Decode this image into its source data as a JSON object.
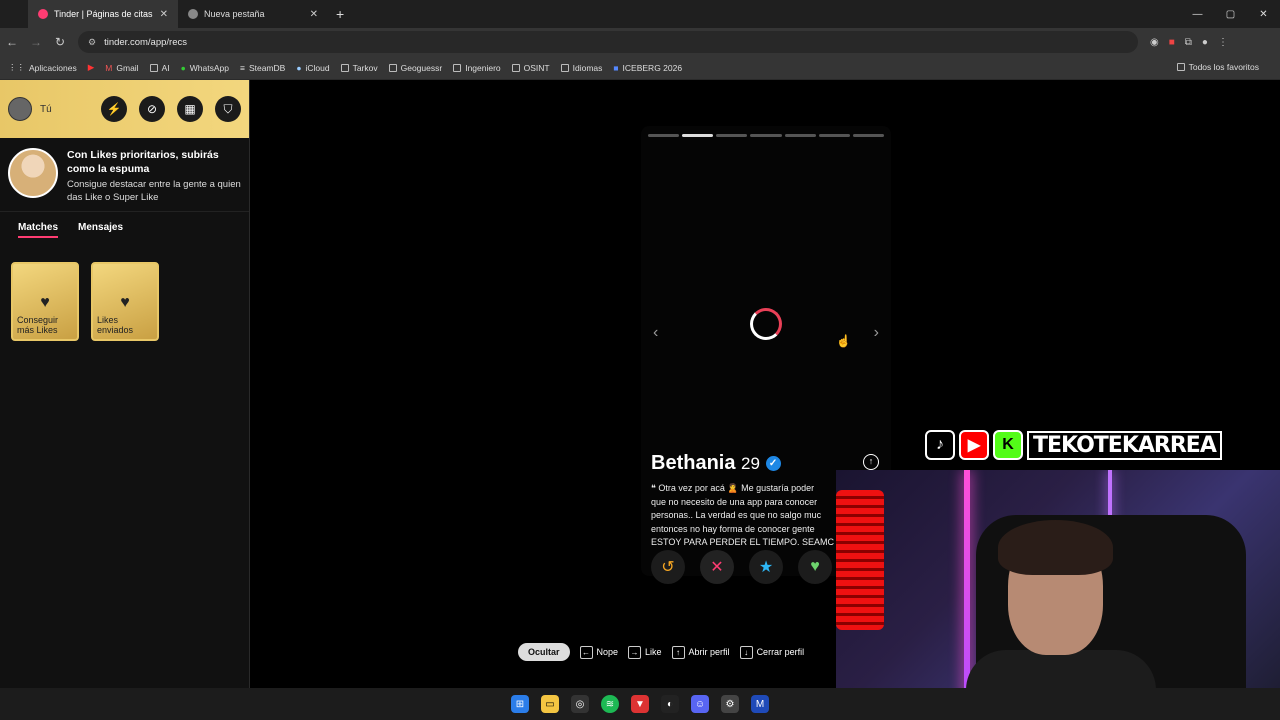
{
  "browser": {
    "tabs": [
      {
        "title": "Tinder | Páginas de citas",
        "active": true
      },
      {
        "title": "Nueva pestaña",
        "active": false
      }
    ],
    "url": "tinder.com/app/recs",
    "bookmarks": [
      "Aplicaciones",
      "Gmail",
      "AI",
      "WhatsApp",
      "SteamDB",
      "iCloud",
      "Tarkov",
      "Geoguessr",
      "Ingeniero",
      "OSINT",
      "Idiomas",
      "ICEBERG 2026"
    ],
    "bookmarks_right": "Todos los favoritos"
  },
  "sidebar": {
    "user_label": "Tú",
    "promo_title": "Con Likes prioritarios, subirás como la espuma",
    "promo_subtitle": "Consigue destacar entre la gente a quien das Like o Super Like",
    "tabs": [
      "Matches",
      "Mensajes"
    ],
    "cards": [
      "Conseguir más Likes",
      "Likes enviados"
    ]
  },
  "profile": {
    "name": "Bethania",
    "age": "29",
    "photo_count": 7,
    "current_photo": 2,
    "bio_lines": [
      "❝ Otra vez por acá 🙎 Me gustaría poder",
      "que no necesito de una app para conocer",
      "personas.. La verdad es que no salgo muc",
      "entonces no hay forma de conocer gente",
      "ESTOY PARA PERDER EL TIEMPO. SEAMC"
    ]
  },
  "shortcuts": {
    "hide_label": "Ocultar",
    "items": [
      "Nope",
      "Like",
      "Abrir perfil",
      "Cerrar perfil"
    ]
  },
  "overlay": {
    "channel": "TEKOTEKARREA"
  },
  "colors": {
    "accent": "#fe3c72",
    "gold": "#e8c767"
  }
}
